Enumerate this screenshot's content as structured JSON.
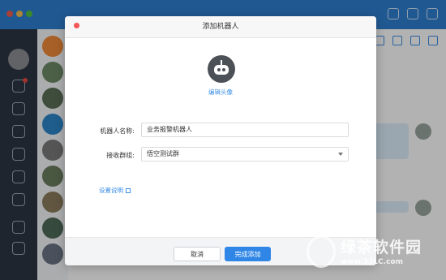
{
  "dialog": {
    "title": "添加机器人",
    "edit_avatar_label": "编辑头像",
    "robot_name_label": "机器人名称:",
    "robot_name_value": "业务报警机器人",
    "receive_group_label": "接收群组:",
    "receive_group_value": "悟空测试群",
    "setup_link": "设置说明",
    "cancel_label": "取消",
    "confirm_label": "完成添加"
  },
  "watermark": {
    "brand": "绿茶软件园",
    "url": "www.33LC.com"
  },
  "colors": {
    "titlebar": "#2f80d1",
    "leftnav": "#2b3643",
    "accent": "#2f86e6"
  },
  "icons": [
    "robot-avatar-icon",
    "external-link-icon",
    "close-dot-icon",
    "dropdown-arrow-icon"
  ]
}
